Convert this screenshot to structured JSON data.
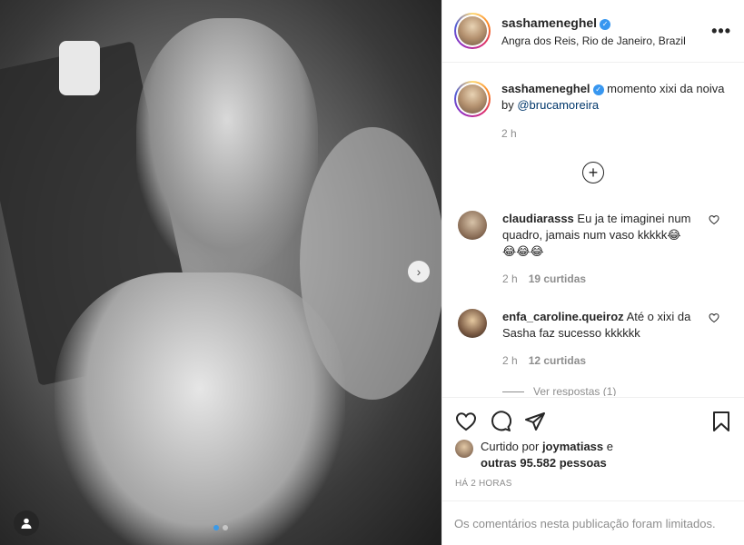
{
  "post": {
    "author": "sashameneghel",
    "location": "Angra dos Reis, Rio de Janeiro, Brazil",
    "more_label": "•••",
    "next_arrow": "›",
    "carousel_count": 2
  },
  "caption": {
    "username": "sashameneghel",
    "text": "momento xixi da noiva by",
    "mention": "@brucamoreira",
    "time": "2 h"
  },
  "load_more_label": "+",
  "comments": [
    {
      "username": "claudiarasss",
      "text": "Eu ja te imaginei num quadro, jamais num vaso kkkkk😂😂😂😂",
      "time": "2 h",
      "likes": "19 curtidas"
    },
    {
      "username": "enfa_caroline.queiroz",
      "text": "Até o xixi da Sasha faz sucesso kkkkkk",
      "time": "2 h",
      "likes": "12 curtidas"
    }
  ],
  "see_replies": "Ver respostas (1)",
  "likes": {
    "prefix": "Curtido por",
    "user": "joymatiass",
    "middle": "e",
    "others": "outras 95.582 pessoas"
  },
  "timestamp": "HÁ 2 HORAS",
  "limited_comments": "Os comentários nesta publicação foram limitados.",
  "icons": {
    "verified": "verified-badge-icon",
    "like": "heart-icon",
    "comment": "comment-icon",
    "share": "paper-plane-icon",
    "save": "bookmark-icon",
    "user_tag": "user-tag-icon"
  },
  "colors": {
    "link": "#00376b",
    "verified": "#3897f0",
    "muted": "#8e8e8e",
    "carousel_active": "#3b9ae8"
  }
}
